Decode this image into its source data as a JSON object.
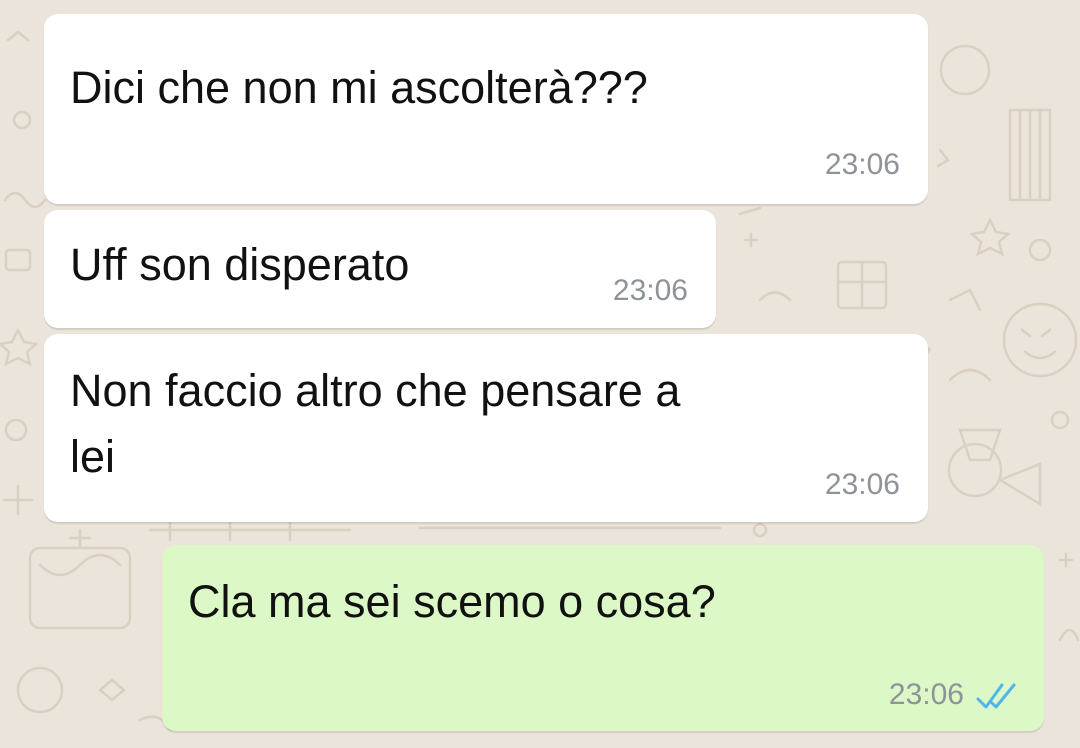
{
  "chat": {
    "messages": [
      {
        "direction": "incoming",
        "text": "Dici che non mi ascolterà???",
        "time": "23:06"
      },
      {
        "direction": "incoming",
        "text": "Uff son disperato",
        "time": "23:06"
      },
      {
        "direction": "incoming",
        "text": "Non faccio altro che pensare a\nlei",
        "time": "23:06"
      },
      {
        "direction": "outgoing",
        "text": "Cla ma sei scemo o cosa?",
        "time": "23:06",
        "status_icon": "double-check-read-icon"
      }
    ]
  },
  "colors": {
    "background": "#ebe4da",
    "incoming_bubble": "#ffffff",
    "outgoing_bubble": "#dcf8c6",
    "read_ticks": "#4fb6ec",
    "timestamp": "#8d9399"
  }
}
